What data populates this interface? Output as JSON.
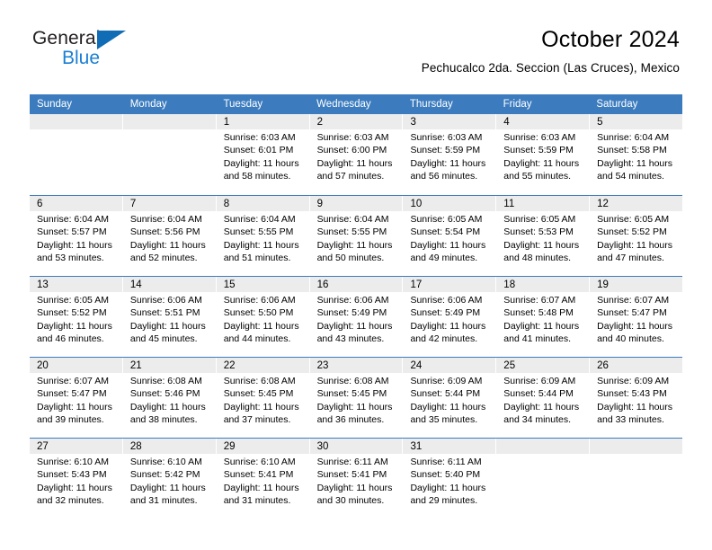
{
  "brand": {
    "name_line1": "General",
    "name_line2": "Blue"
  },
  "header": {
    "title": "October 2024",
    "subtitle": "Pechucalco 2da. Seccion (Las Cruces), Mexico"
  },
  "colors": {
    "header_blue": "#3c7cbe",
    "band_gray": "#ececec",
    "logo_blue": "#1b7fd4",
    "logo_triangle": "#0f6cb5"
  },
  "weekday_headers": [
    "Sunday",
    "Monday",
    "Tuesday",
    "Wednesday",
    "Thursday",
    "Friday",
    "Saturday"
  ],
  "weeks": [
    [
      {
        "day": "",
        "lines": []
      },
      {
        "day": "",
        "lines": []
      },
      {
        "day": "1",
        "lines": [
          "Sunrise: 6:03 AM",
          "Sunset: 6:01 PM",
          "Daylight: 11 hours",
          "and 58 minutes."
        ]
      },
      {
        "day": "2",
        "lines": [
          "Sunrise: 6:03 AM",
          "Sunset: 6:00 PM",
          "Daylight: 11 hours",
          "and 57 minutes."
        ]
      },
      {
        "day": "3",
        "lines": [
          "Sunrise: 6:03 AM",
          "Sunset: 5:59 PM",
          "Daylight: 11 hours",
          "and 56 minutes."
        ]
      },
      {
        "day": "4",
        "lines": [
          "Sunrise: 6:03 AM",
          "Sunset: 5:59 PM",
          "Daylight: 11 hours",
          "and 55 minutes."
        ]
      },
      {
        "day": "5",
        "lines": [
          "Sunrise: 6:04 AM",
          "Sunset: 5:58 PM",
          "Daylight: 11 hours",
          "and 54 minutes."
        ]
      }
    ],
    [
      {
        "day": "6",
        "lines": [
          "Sunrise: 6:04 AM",
          "Sunset: 5:57 PM",
          "Daylight: 11 hours",
          "and 53 minutes."
        ]
      },
      {
        "day": "7",
        "lines": [
          "Sunrise: 6:04 AM",
          "Sunset: 5:56 PM",
          "Daylight: 11 hours",
          "and 52 minutes."
        ]
      },
      {
        "day": "8",
        "lines": [
          "Sunrise: 6:04 AM",
          "Sunset: 5:55 PM",
          "Daylight: 11 hours",
          "and 51 minutes."
        ]
      },
      {
        "day": "9",
        "lines": [
          "Sunrise: 6:04 AM",
          "Sunset: 5:55 PM",
          "Daylight: 11 hours",
          "and 50 minutes."
        ]
      },
      {
        "day": "10",
        "lines": [
          "Sunrise: 6:05 AM",
          "Sunset: 5:54 PM",
          "Daylight: 11 hours",
          "and 49 minutes."
        ]
      },
      {
        "day": "11",
        "lines": [
          "Sunrise: 6:05 AM",
          "Sunset: 5:53 PM",
          "Daylight: 11 hours",
          "and 48 minutes."
        ]
      },
      {
        "day": "12",
        "lines": [
          "Sunrise: 6:05 AM",
          "Sunset: 5:52 PM",
          "Daylight: 11 hours",
          "and 47 minutes."
        ]
      }
    ],
    [
      {
        "day": "13",
        "lines": [
          "Sunrise: 6:05 AM",
          "Sunset: 5:52 PM",
          "Daylight: 11 hours",
          "and 46 minutes."
        ]
      },
      {
        "day": "14",
        "lines": [
          "Sunrise: 6:06 AM",
          "Sunset: 5:51 PM",
          "Daylight: 11 hours",
          "and 45 minutes."
        ]
      },
      {
        "day": "15",
        "lines": [
          "Sunrise: 6:06 AM",
          "Sunset: 5:50 PM",
          "Daylight: 11 hours",
          "and 44 minutes."
        ]
      },
      {
        "day": "16",
        "lines": [
          "Sunrise: 6:06 AM",
          "Sunset: 5:49 PM",
          "Daylight: 11 hours",
          "and 43 minutes."
        ]
      },
      {
        "day": "17",
        "lines": [
          "Sunrise: 6:06 AM",
          "Sunset: 5:49 PM",
          "Daylight: 11 hours",
          "and 42 minutes."
        ]
      },
      {
        "day": "18",
        "lines": [
          "Sunrise: 6:07 AM",
          "Sunset: 5:48 PM",
          "Daylight: 11 hours",
          "and 41 minutes."
        ]
      },
      {
        "day": "19",
        "lines": [
          "Sunrise: 6:07 AM",
          "Sunset: 5:47 PM",
          "Daylight: 11 hours",
          "and 40 minutes."
        ]
      }
    ],
    [
      {
        "day": "20",
        "lines": [
          "Sunrise: 6:07 AM",
          "Sunset: 5:47 PM",
          "Daylight: 11 hours",
          "and 39 minutes."
        ]
      },
      {
        "day": "21",
        "lines": [
          "Sunrise: 6:08 AM",
          "Sunset: 5:46 PM",
          "Daylight: 11 hours",
          "and 38 minutes."
        ]
      },
      {
        "day": "22",
        "lines": [
          "Sunrise: 6:08 AM",
          "Sunset: 5:45 PM",
          "Daylight: 11 hours",
          "and 37 minutes."
        ]
      },
      {
        "day": "23",
        "lines": [
          "Sunrise: 6:08 AM",
          "Sunset: 5:45 PM",
          "Daylight: 11 hours",
          "and 36 minutes."
        ]
      },
      {
        "day": "24",
        "lines": [
          "Sunrise: 6:09 AM",
          "Sunset: 5:44 PM",
          "Daylight: 11 hours",
          "and 35 minutes."
        ]
      },
      {
        "day": "25",
        "lines": [
          "Sunrise: 6:09 AM",
          "Sunset: 5:44 PM",
          "Daylight: 11 hours",
          "and 34 minutes."
        ]
      },
      {
        "day": "26",
        "lines": [
          "Sunrise: 6:09 AM",
          "Sunset: 5:43 PM",
          "Daylight: 11 hours",
          "and 33 minutes."
        ]
      }
    ],
    [
      {
        "day": "27",
        "lines": [
          "Sunrise: 6:10 AM",
          "Sunset: 5:43 PM",
          "Daylight: 11 hours",
          "and 32 minutes."
        ]
      },
      {
        "day": "28",
        "lines": [
          "Sunrise: 6:10 AM",
          "Sunset: 5:42 PM",
          "Daylight: 11 hours",
          "and 31 minutes."
        ]
      },
      {
        "day": "29",
        "lines": [
          "Sunrise: 6:10 AM",
          "Sunset: 5:41 PM",
          "Daylight: 11 hours",
          "and 31 minutes."
        ]
      },
      {
        "day": "30",
        "lines": [
          "Sunrise: 6:11 AM",
          "Sunset: 5:41 PM",
          "Daylight: 11 hours",
          "and 30 minutes."
        ]
      },
      {
        "day": "31",
        "lines": [
          "Sunrise: 6:11 AM",
          "Sunset: 5:40 PM",
          "Daylight: 11 hours",
          "and 29 minutes."
        ]
      },
      {
        "day": "",
        "lines": []
      },
      {
        "day": "",
        "lines": []
      }
    ]
  ]
}
